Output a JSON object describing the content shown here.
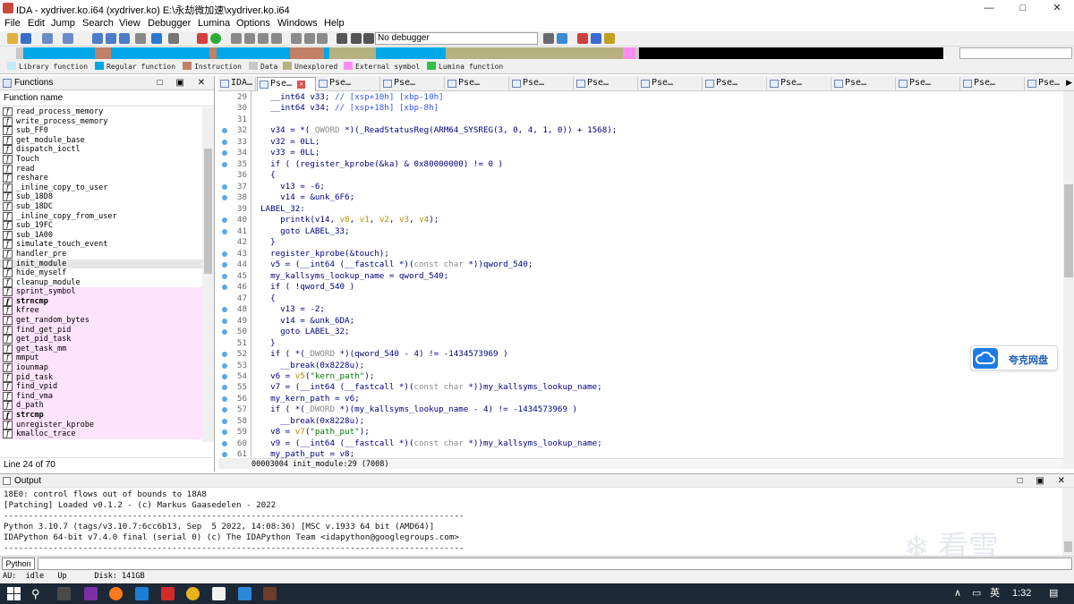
{
  "window": {
    "title": "IDA - xydriver.ko.i64 (xydriver.ko) E:\\永劫微加速\\xydriver.ko.i64",
    "controls": [
      "—",
      "□",
      "✕"
    ]
  },
  "menu": [
    "File",
    "Edit",
    "Jump",
    "Search",
    "View",
    "Debugger",
    "Lumina",
    "Options",
    "Windows",
    "Help"
  ],
  "toolbar": {
    "debugger_select": "No debugger"
  },
  "legend": [
    {
      "label": "Library function",
      "color": "#c2e9f7"
    },
    {
      "label": "Regular function",
      "color": "#00a8e8"
    },
    {
      "label": "Instruction",
      "color": "#c28167"
    },
    {
      "label": "Data",
      "color": "#c8c8c8"
    },
    {
      "label": "Unexplored",
      "color": "#b5b27f"
    },
    {
      "label": "External symbol",
      "color": "#ff8cf0"
    },
    {
      "label": "Lumina function",
      "color": "#2ec441"
    }
  ],
  "functions_pane": {
    "title": "Functions",
    "column": "Function name",
    "line_count": "Line 24 of 70",
    "items": [
      {
        "name": "read_process_memory",
        "style": ""
      },
      {
        "name": "write_process_memory",
        "style": ""
      },
      {
        "name": "sub_FF0",
        "style": ""
      },
      {
        "name": "get_module_base",
        "style": ""
      },
      {
        "name": "dispatch_ioctl",
        "style": ""
      },
      {
        "name": "Touch",
        "style": ""
      },
      {
        "name": "read",
        "style": ""
      },
      {
        "name": "reshare",
        "style": ""
      },
      {
        "name": "_inline_copy_to_user",
        "style": ""
      },
      {
        "name": "sub_18D8",
        "style": ""
      },
      {
        "name": "sub_18DC",
        "style": ""
      },
      {
        "name": "_inline_copy_from_user",
        "style": ""
      },
      {
        "name": "sub_19FC",
        "style": ""
      },
      {
        "name": "sub_1A00",
        "style": ""
      },
      {
        "name": "simulate_touch_event",
        "style": ""
      },
      {
        "name": "handler_pre",
        "style": ""
      },
      {
        "name": "init_module",
        "style": "sel"
      },
      {
        "name": "hide_myself",
        "style": ""
      },
      {
        "name": "cleanup_module",
        "style": ""
      },
      {
        "name": "sprint_symbol",
        "style": "pink"
      },
      {
        "name": "strncmp",
        "style": "pink bold"
      },
      {
        "name": "kfree",
        "style": "pink"
      },
      {
        "name": "get_random_bytes",
        "style": "pink"
      },
      {
        "name": "find_get_pid",
        "style": "pink"
      },
      {
        "name": "get_pid_task",
        "style": "pink"
      },
      {
        "name": "get_task_mm",
        "style": "pink"
      },
      {
        "name": "mmput",
        "style": "pink"
      },
      {
        "name": "iounmap",
        "style": "pink"
      },
      {
        "name": "pid_task",
        "style": "pink"
      },
      {
        "name": "find_vpid",
        "style": "pink"
      },
      {
        "name": "find_vma",
        "style": "pink"
      },
      {
        "name": "d_path",
        "style": "pink"
      },
      {
        "name": "strcmp",
        "style": "pink bold"
      },
      {
        "name": "unregister_kprobe",
        "style": "pink"
      },
      {
        "name": "kmalloc_trace",
        "style": "pink"
      }
    ]
  },
  "tabs": [
    {
      "label": "IDA…",
      "active": false
    },
    {
      "label": "Pse…",
      "active": true,
      "closable": true
    },
    {
      "label": "Pse…",
      "active": false
    },
    {
      "label": "Pse…",
      "active": false
    },
    {
      "label": "Pse…",
      "active": false
    },
    {
      "label": "Pse…",
      "active": false
    },
    {
      "label": "Pse…",
      "active": false
    },
    {
      "label": "Pse…",
      "active": false
    },
    {
      "label": "Pse…",
      "active": false
    },
    {
      "label": "Pse…",
      "active": false
    },
    {
      "label": "Pse…",
      "active": false
    },
    {
      "label": "Pse…",
      "active": false
    },
    {
      "label": "Pse…",
      "active": false
    },
    {
      "label": "Pse…",
      "active": false
    }
  ],
  "code_lines": [
    {
      "n": "29",
      "dot": false,
      "html": "  __int64 v33; <span class='cm'>// [xsp+10h] [xbp-10h]</span>"
    },
    {
      "n": "30",
      "dot": false,
      "html": "  __int64 v34; <span class='cm'>// [xsp+18h] [xbp-8h]</span>"
    },
    {
      "n": "31",
      "dot": false,
      "html": ""
    },
    {
      "n": "32",
      "dot": true,
      "html": "  v34 = *(<span class='gy'>_QWORD</span> *)(_ReadStatusReg(ARM64_SYSREG(3, 0, 4, 1, 0)) + 1568);"
    },
    {
      "n": "33",
      "dot": true,
      "html": "  v32 = 0LL;"
    },
    {
      "n": "34",
      "dot": true,
      "html": "  v33 = 0LL;"
    },
    {
      "n": "35",
      "dot": true,
      "html": "  if ( (register_kprobe(&amp;ka) &amp; 0x80000000) != 0 )"
    },
    {
      "n": "36",
      "dot": false,
      "html": "  {"
    },
    {
      "n": "37",
      "dot": true,
      "html": "    v13 = -6;"
    },
    {
      "n": "38",
      "dot": true,
      "html": "    v14 = &amp;unk_6F6;"
    },
    {
      "n": "39",
      "dot": false,
      "html": "LABEL_32:"
    },
    {
      "n": "40",
      "dot": true,
      "html": "    printk(v14, <span class='a1'>v0</span>, <span class='a1'>v1</span>, <span class='a1'>v2</span>, <span class='a1'>v3</span>, <span class='a1'>v4</span>);"
    },
    {
      "n": "41",
      "dot": true,
      "html": "    goto LABEL_33;"
    },
    {
      "n": "42",
      "dot": false,
      "html": "  }"
    },
    {
      "n": "43",
      "dot": true,
      "html": "  register_kprobe(&amp;touch);"
    },
    {
      "n": "44",
      "dot": true,
      "html": "  v5 = (__int64 (__fastcall *)(<span class='gy'>const char</span> *))qword_540;"
    },
    {
      "n": "45",
      "dot": true,
      "html": "  my_kallsyms_lookup_name = qword_540;"
    },
    {
      "n": "46",
      "dot": true,
      "html": "  if ( !qword_540 )"
    },
    {
      "n": "47",
      "dot": false,
      "html": "  {"
    },
    {
      "n": "48",
      "dot": true,
      "html": "    v13 = -2;"
    },
    {
      "n": "49",
      "dot": true,
      "html": "    v14 = &amp;unk_6DA;"
    },
    {
      "n": "50",
      "dot": true,
      "html": "    goto LABEL_32;"
    },
    {
      "n": "51",
      "dot": false,
      "html": "  }"
    },
    {
      "n": "52",
      "dot": true,
      "html": "  if ( *(<span class='gy'>_DWORD</span> *)(qword_540 - 4) != -1434573969 )"
    },
    {
      "n": "53",
      "dot": true,
      "html": "    __break(0x8228u);"
    },
    {
      "n": "54",
      "dot": true,
      "html": "  v6 = <span class='a1'>v5</span>(<span class='st'>\"kern_path\"</span>);"
    },
    {
      "n": "55",
      "dot": true,
      "html": "  v7 = (__int64 (__fastcall *)(<span class='gy'>const char</span> *))my_kallsyms_lookup_name;"
    },
    {
      "n": "56",
      "dot": true,
      "html": "  my_kern_path = v6;"
    },
    {
      "n": "57",
      "dot": true,
      "html": "  if ( *(<span class='gy'>_DWORD</span> *)(my_kallsyms_lookup_name - 4) != -1434573969 )"
    },
    {
      "n": "58",
      "dot": true,
      "html": "    __break(0x8228u);"
    },
    {
      "n": "59",
      "dot": true,
      "html": "  v8 = <span class='a1'>v7</span>(<span class='st'>\"path_put\"</span>);"
    },
    {
      "n": "60",
      "dot": true,
      "html": "  v9 = (__int64 (__fastcall *)(<span class='gy'>const char</span> *))my_kallsyms_lookup_name;"
    },
    {
      "n": "61",
      "dot": true,
      "html": "  my_path_put = v8;"
    }
  ],
  "code_status": "00003004 init_module:29 (7008)",
  "output": {
    "title": "Output",
    "lines": [
      "18E0: control flows out of bounds to 18A8",
      "[Patching] Loaded v0.1.2 - (c) Markus Gaasedelen - 2022",
      "---------------------------------------------------------------------------------------------",
      "Python 3.10.7 (tags/v3.10.7:6cc6b13, Sep  5 2022, 14:08:36) [MSC v.1933 64 bit (AMD64)]",
      "IDAPython 64-bit v7.4.0 final (serial 0) (c) The IDAPython Team <idapython@googlegroups.com>",
      "---------------------------------------------------------------------------------------------"
    ]
  },
  "python_button": "Python",
  "statusbar": "AU:  idle   Up      Disk: 141GB",
  "quark_badge": "夸克网盘",
  "watermark": "看雪",
  "taskbar": {
    "ime": "英",
    "time": "1:32"
  }
}
